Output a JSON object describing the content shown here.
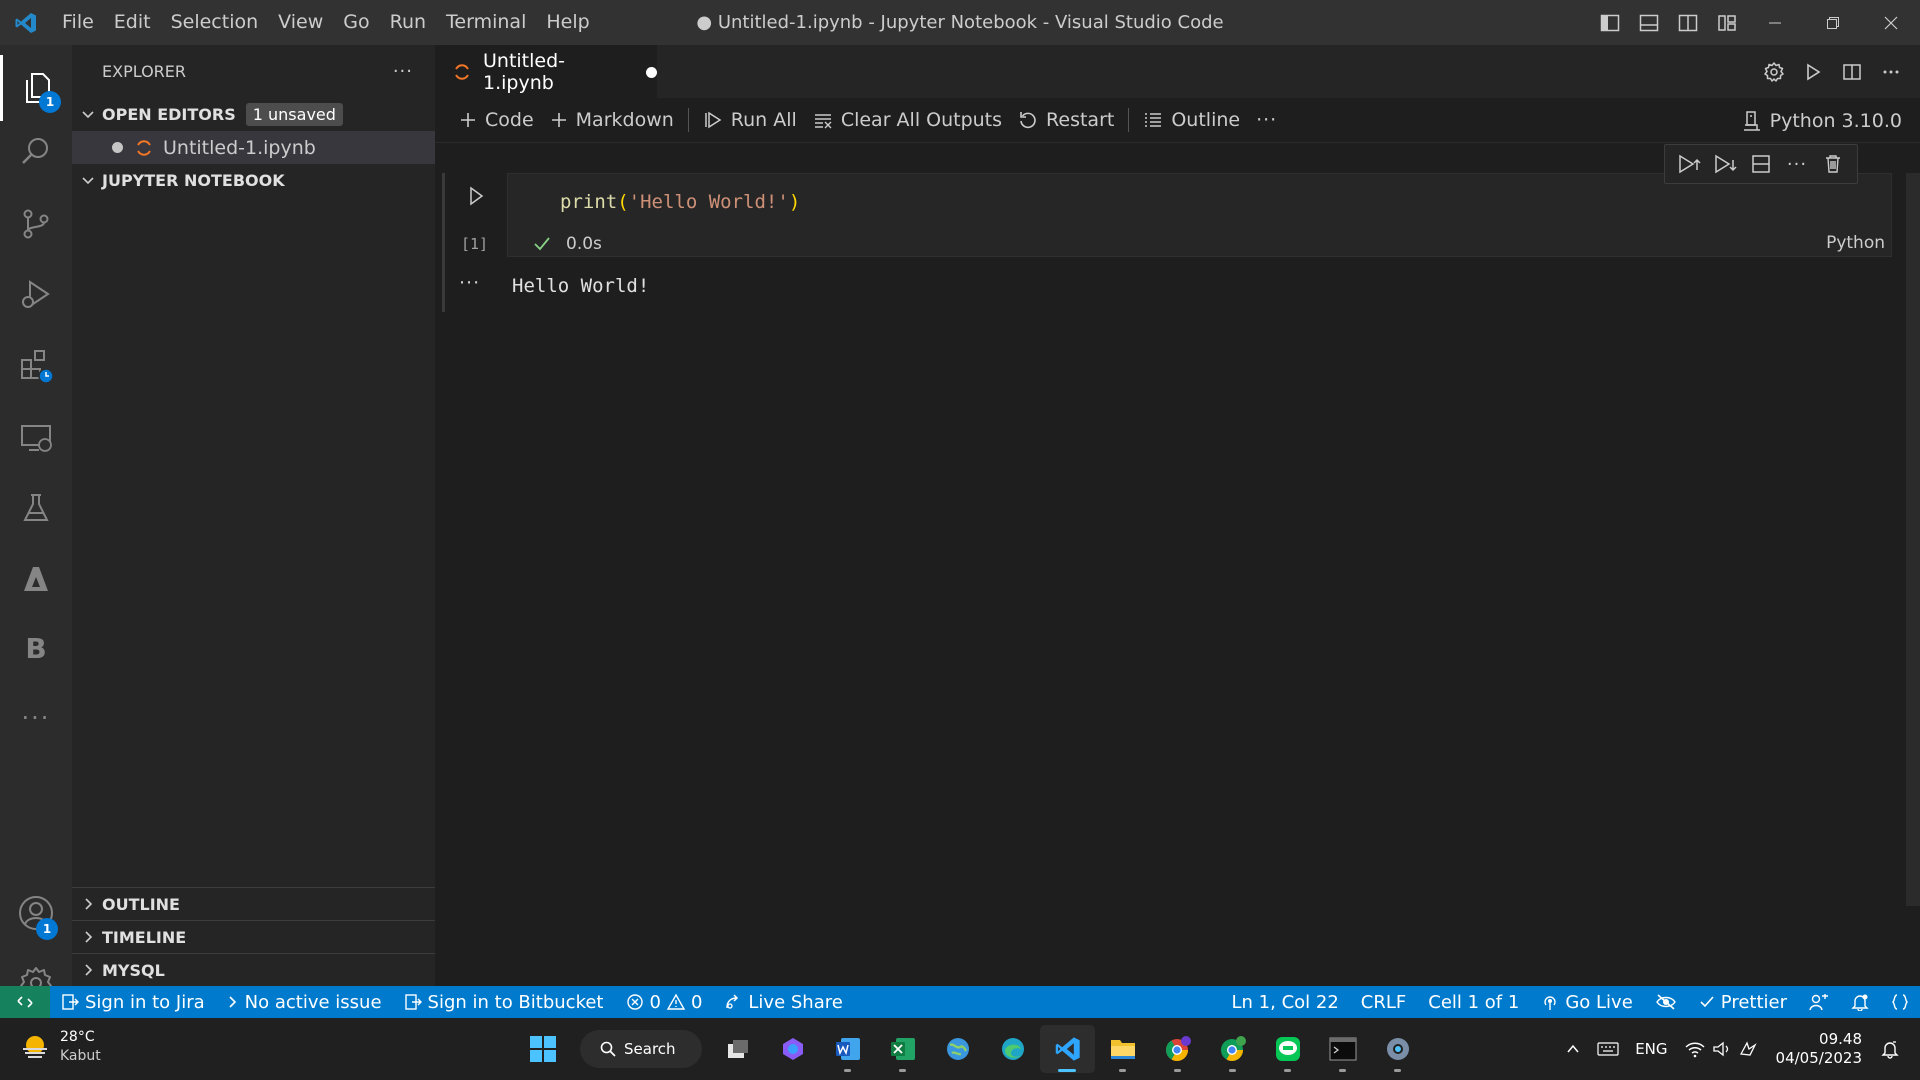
{
  "window": {
    "title": "● Untitled-1.ipynb - Jupyter Notebook - Visual Studio Code"
  },
  "menu": [
    "File",
    "Edit",
    "Selection",
    "View",
    "Go",
    "Run",
    "Terminal",
    "Help"
  ],
  "activity_bar": {
    "explorer_badge": "1",
    "accounts_badge": "1",
    "letter_icon": "B",
    "more": "···"
  },
  "sidebar": {
    "header": "EXPLORER",
    "more": "···",
    "open_editors": {
      "label": "OPEN EDITORS",
      "badge": "1 unsaved",
      "file": "Untitled-1.ipynb"
    },
    "jupyter_section": "JUPYTER NOTEBOOK",
    "outline": "OUTLINE",
    "timeline": "TIMELINE",
    "mysql": "MYSQL"
  },
  "tab": {
    "label": "Untitled-1.ipynb"
  },
  "notebook_toolbar": {
    "code": "Code",
    "markdown": "Markdown",
    "run_all": "Run All",
    "clear_outputs": "Clear All Outputs",
    "restart": "Restart",
    "outline": "Outline",
    "more": "···",
    "kernel": "Python 3.10.0"
  },
  "cell": {
    "exec_count": "[1]",
    "code_fn": "print",
    "code_open": "(",
    "code_str": "'Hello World!'",
    "code_close": ")",
    "exec_time": "0.0s",
    "language": "Python",
    "output_dots": "···",
    "output": "Hello World!",
    "toolbar_more": "···"
  },
  "status_bar": {
    "jira": "Sign in to Jira",
    "issue": "No active issue",
    "bitbucket": "Sign in to Bitbucket",
    "errors": "0",
    "warnings": "0",
    "live_share": "Live Share",
    "position": "Ln 1, Col 22",
    "eol": "CRLF",
    "cell": "Cell 1 of 1",
    "go_live": "Go Live",
    "prettier": "Prettier"
  },
  "taskbar": {
    "temperature": "28°C",
    "weather": "Kabut",
    "search": "Search",
    "language": "ENG",
    "time": "09.48",
    "date": "04/05/2023"
  },
  "colors": {
    "accent": "#007acc",
    "remote": "#16825d",
    "badge": "#0078d4",
    "jupyter": "#f37626"
  }
}
